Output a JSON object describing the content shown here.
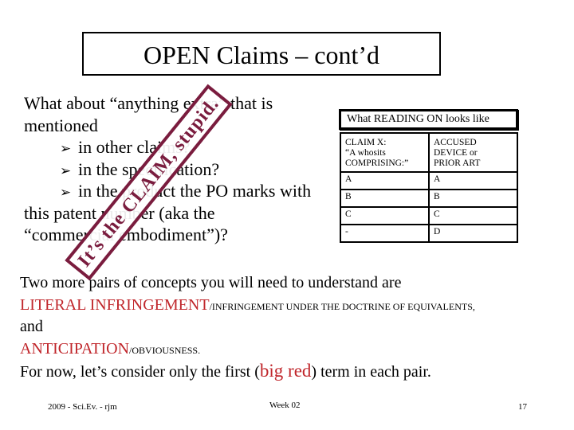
{
  "slide": {
    "title": "OPEN Claims – cont’d",
    "intro_line1": "What about “anything extra” that is",
    "intro_line2": "mentioned",
    "bullet_glyph": "➢",
    "bullets": [
      "in other claims?",
      "in the specification?",
      "in the product the PO marks with"
    ],
    "bullet3_cont1": "this patent number (aka the",
    "bullet3_cont2": "“commercial embodiment”)?",
    "stamp_text": "It’s the CLAIM, stupid.",
    "stamp_color": "#7a1c3e"
  },
  "table": {
    "caption": "What READING ON looks like",
    "header_left": [
      "CLAIM X:",
      "“A whosits",
      "COMPRISING:”"
    ],
    "header_right": [
      "ACCUSED",
      "DEVICE or",
      "PRIOR ART"
    ],
    "rows": [
      {
        "claim": "A",
        "device": "A"
      },
      {
        "claim": "B",
        "device": "B"
      },
      {
        "claim": "C",
        "device": "C"
      },
      {
        "claim": "-",
        "device": "D"
      }
    ]
  },
  "lower": {
    "line1": "Two more pairs of concepts you will need to understand are",
    "pair1_big": "LITERAL INFRINGEMENT",
    "pair1_small": "/INFRINGEMENT UNDER THE DOCTRINE OF EQUIVALENTS,",
    "and": "and",
    "pair2_big": "ANTICIPATION",
    "pair2_small": "/OBVIOUSNESS.",
    "last_pre": "For now, let’s consider only the first (",
    "last_red": "big red",
    "last_post": ") term in each pair.",
    "accent_color": "#c0262b"
  },
  "footer": {
    "left": "2009 - Sci.Ev. - rjm",
    "center": "Week 02",
    "page_number": "17"
  }
}
